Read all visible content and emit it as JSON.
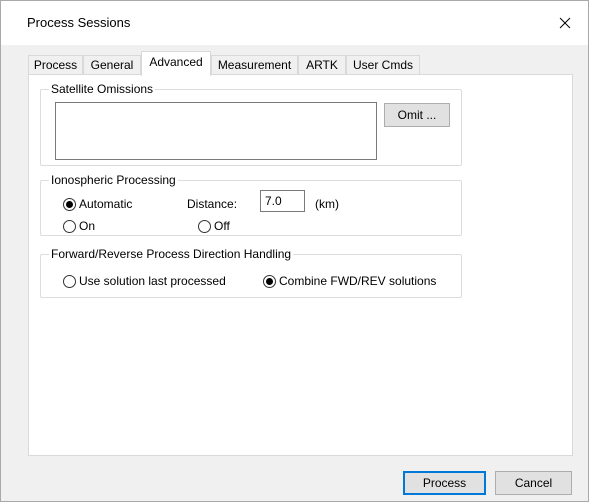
{
  "window": {
    "title": "Process Sessions"
  },
  "tabs": [
    {
      "label": "Process"
    },
    {
      "label": "General"
    },
    {
      "label": "Advanced",
      "active": true
    },
    {
      "label": "Measurement"
    },
    {
      "label": "ARTK"
    },
    {
      "label": "User Cmds"
    }
  ],
  "satellite_omissions": {
    "title": "Satellite Omissions",
    "omit_button": "Omit ..."
  },
  "ionospheric": {
    "title": "Ionospheric Processing",
    "automatic_label": "Automatic",
    "automatic_checked": true,
    "on_label": "On",
    "on_checked": false,
    "distance_label": "Distance:",
    "distance_value": "7.0",
    "distance_unit": "(km)",
    "off_label": "Off",
    "off_checked": false
  },
  "direction": {
    "title": "Forward/Reverse Process Direction Handling",
    "last_label": "Use solution last processed",
    "last_checked": false,
    "combine_label": "Combine FWD/REV solutions",
    "combine_checked": true
  },
  "footer": {
    "process_button": "Process",
    "cancel_button": "Cancel"
  },
  "colors": {
    "accent": "#0078d7",
    "window_bg": "#f0f0f0",
    "panel_bg": "#ffffff"
  }
}
